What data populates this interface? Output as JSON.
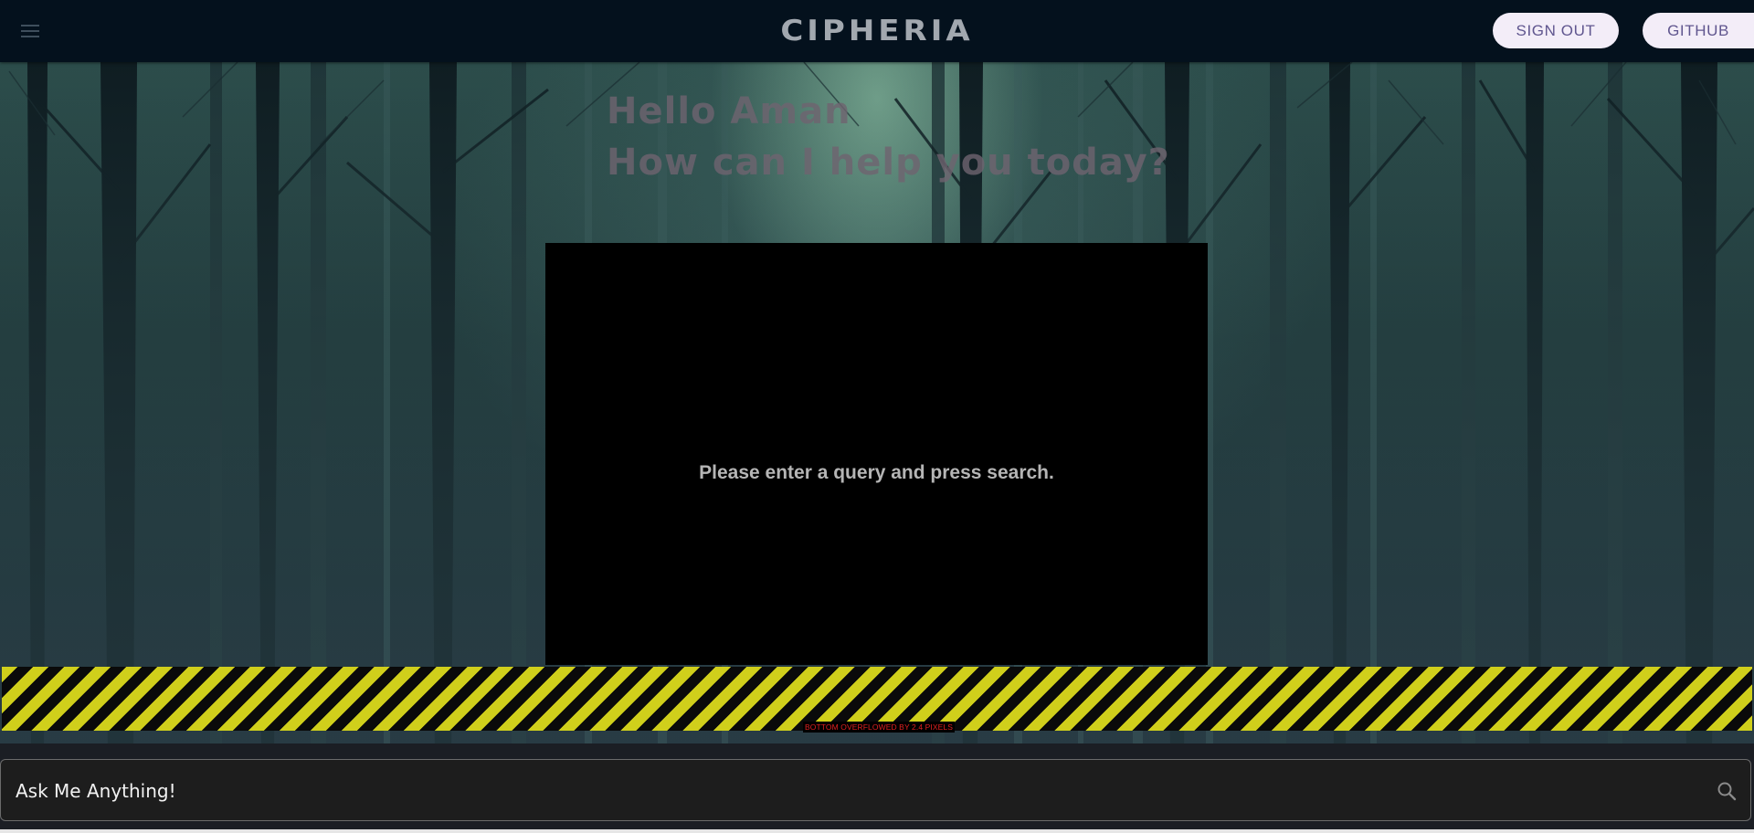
{
  "app_bar": {
    "title": "CIPHERIA",
    "menu_icon": "hamburger-menu-icon",
    "sign_out_label": "SIGN OUT",
    "github_label": "GITHUB"
  },
  "greeting": {
    "line1": "Hello Aman",
    "line2": "How can I help you today?"
  },
  "results": {
    "empty_message": "Please enter a query and press search."
  },
  "debug": {
    "overflow_message": "BOTTOM OVERFLOWED BY 2.4 PIXELS"
  },
  "search": {
    "placeholder": "Ask Me Anything!",
    "value": "",
    "icon": "search-icon"
  },
  "colors": {
    "app_bar_bg": "#04111d",
    "pill_bg": "#f3edf8",
    "pill_text": "#60568f",
    "overflow_yellow": "#d0cf1b",
    "overflow_text": "#e02020"
  }
}
